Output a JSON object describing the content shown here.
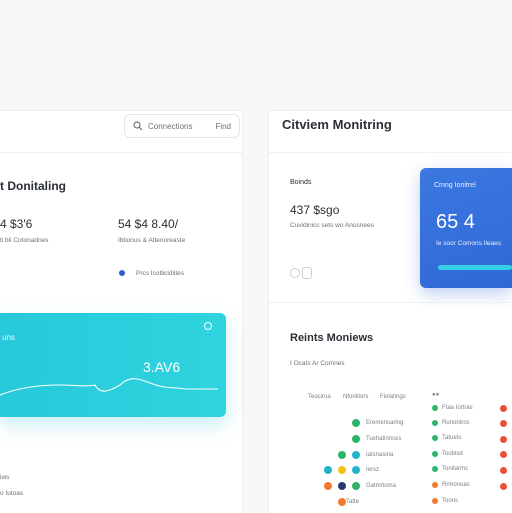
{
  "header": {
    "search_text": "Connections",
    "search_hint": "Find",
    "right_title": "Citviem Monitring"
  },
  "left": {
    "title": "t Donitaling",
    "stat1_value": "4 $3'6",
    "stat1_caption": "ti bli Cotonadnes",
    "stat2_value": "54 $4 8.40/",
    "stat2_caption": "Ibtionus & Attenoreaste",
    "legend_label": "Prcs Icotlicidiites",
    "card_label": "uns",
    "card_value": "3.AV6",
    "bottom_caption1": "iws",
    "bottom_caption2": "o Iutoas"
  },
  "right": {
    "stat_label": "Boinds",
    "stat_value": "437 $sgo",
    "stat_caption": "Cuvidinicc sets wo Anosnees",
    "blue_label": "Cmng Ionitrel",
    "blue_value": "65 4",
    "blue_caption": "Ie soor Comons Ileaes",
    "section_title": "Reints Moniews",
    "section_caption": "I Ocats Ar Comnes",
    "col1_header": "Teuciroa",
    "col2_header": "Ntoriitiors",
    "col3_header": "Fiolatings",
    "rows": [
      {
        "label": "Eremensaring"
      },
      {
        "label": "Tuxhatinnces"
      },
      {
        "label": "Iatsnasina"
      },
      {
        "label": "Iersz"
      },
      {
        "label": "Gatmrtoma"
      },
      {
        "label": "Tatte"
      }
    ],
    "col4_rows": [
      "Ftaa Iortras",
      "Ronontros",
      "Tatuets",
      "Toobisd",
      "Tonitarms",
      "Rrmonoas",
      "Toons"
    ]
  },
  "colors": {
    "cyan": "#2fd4df",
    "blue": "#3c78e0",
    "green": "#2fb36a",
    "teal": "#22b5c7",
    "yellow": "#f2c21b",
    "orange": "#f07a2e",
    "red": "#e8503a",
    "navy": "#2a3a78"
  }
}
